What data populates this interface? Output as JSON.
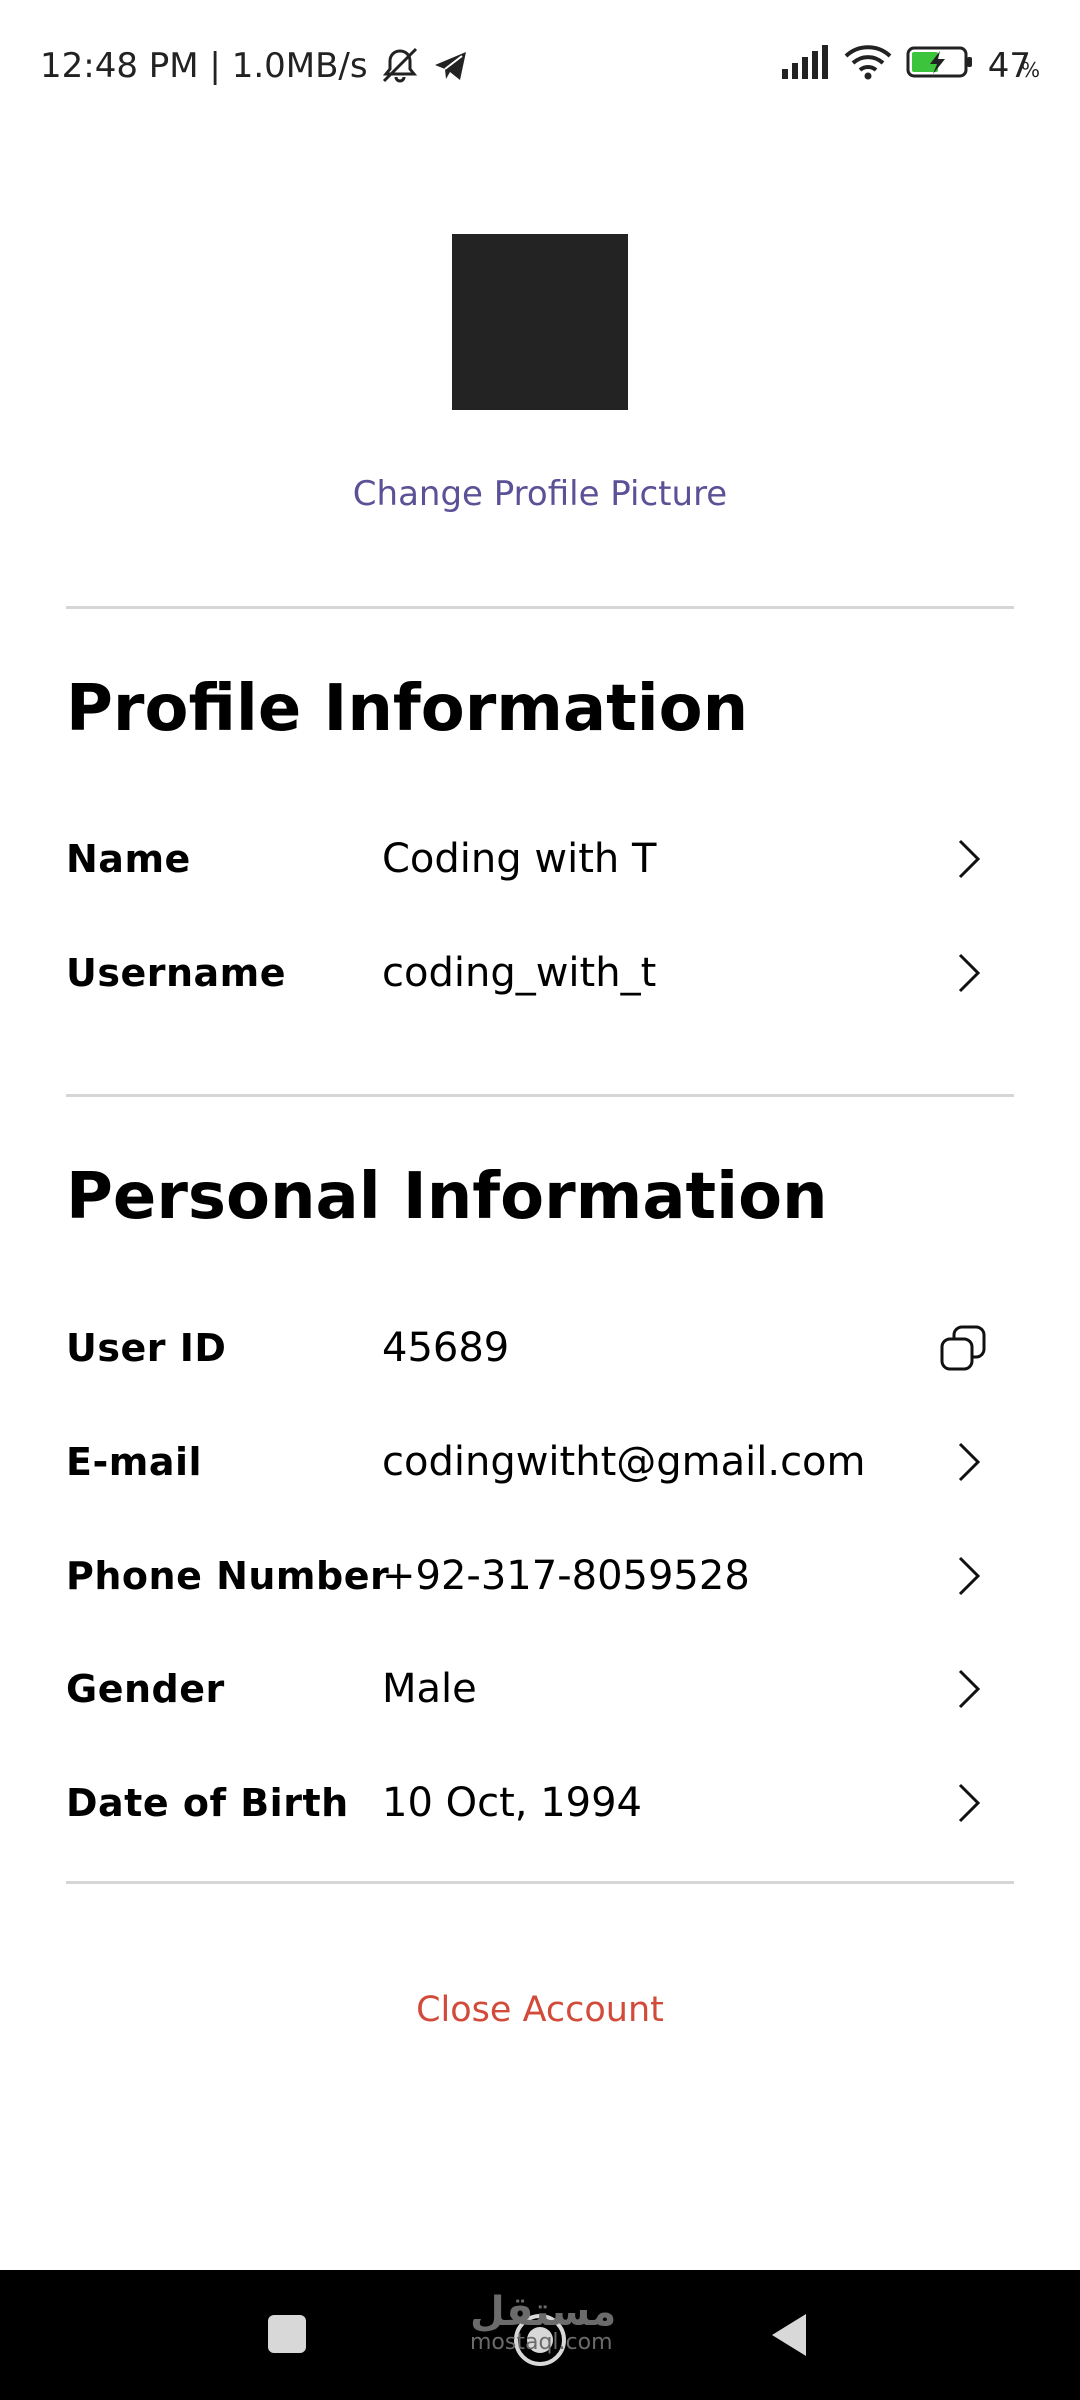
{
  "status_bar": {
    "time_speed": "12:48 PM | 1.0MB/s",
    "battery_percent": "47",
    "percent_sign": "%",
    "icons": [
      "mute-icon",
      "telegram-icon",
      "signal-icon",
      "wifi-icon",
      "battery-charging-icon"
    ]
  },
  "profile_picture": {
    "change_label": "Change Profile Picture"
  },
  "profile_section": {
    "title": "Profile Information",
    "rows": [
      {
        "label": "Name",
        "value": "Coding with T",
        "action_icon": "chevron-right-icon"
      },
      {
        "label": "Username",
        "value": "coding_with_t",
        "action_icon": "chevron-right-icon"
      }
    ]
  },
  "personal_section": {
    "title": "Personal Information",
    "rows": [
      {
        "label": "User ID",
        "value": "45689",
        "action_icon": "copy-icon"
      },
      {
        "label": "E-mail",
        "value": "codingwitht@gmail.com",
        "action_icon": "chevron-right-icon"
      },
      {
        "label": "Phone Number",
        "value": "+92-317-8059528",
        "action_icon": "chevron-right-icon"
      },
      {
        "label": "Gender",
        "value": "Male",
        "action_icon": "chevron-right-icon"
      },
      {
        "label": "Date of Birth",
        "value": "10 Oct, 1994",
        "action_icon": "chevron-right-icon"
      }
    ]
  },
  "close_account_label": "Close Account",
  "watermark": {
    "arabic": "مستقل",
    "latin": "mostaql.com"
  },
  "colors": {
    "accent_link": "#5b5196",
    "danger": "#d24b3a",
    "divider": "#d6d6d6",
    "avatar": "#232323"
  }
}
